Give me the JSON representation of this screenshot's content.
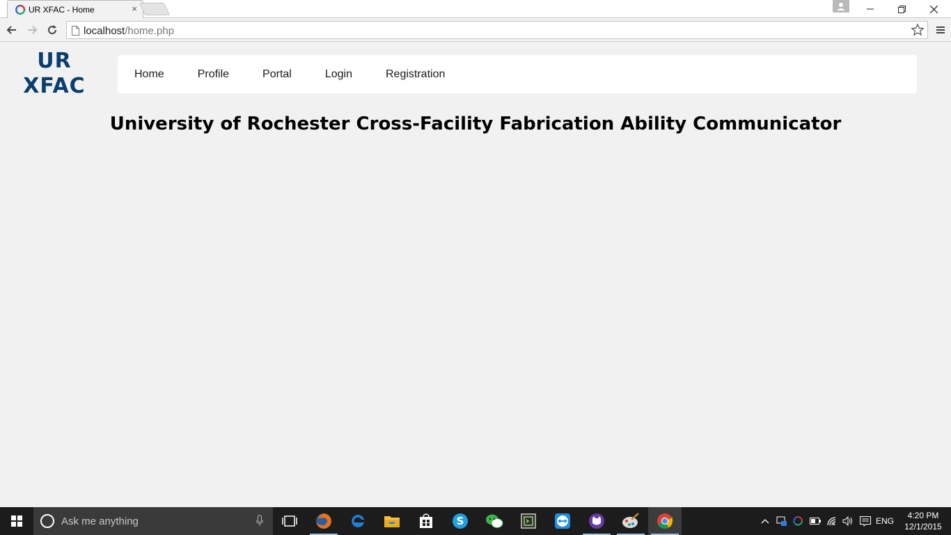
{
  "browser": {
    "tab_title": "UR XFAC - Home",
    "tab_close": "×",
    "url_host": "localhost",
    "url_path": "/home.php"
  },
  "page": {
    "logo_line1": "UR",
    "logo_line2": "XFAC",
    "nav": [
      {
        "label": "Home"
      },
      {
        "label": "Profile"
      },
      {
        "label": "Portal"
      },
      {
        "label": "Login"
      },
      {
        "label": "Registration"
      }
    ],
    "headline": "University of Rochester Cross-Facility Fabrication Ability Communicator",
    "logo_color": "#0a3e6e"
  },
  "taskbar": {
    "search_placeholder": "Ask me anything",
    "apps": [
      "task-view-icon",
      "firefox-icon",
      "edge-icon",
      "file-explorer-icon",
      "store-icon",
      "skype-icon",
      "wechat-icon",
      "terminal-app-icon",
      "teamviewer-icon",
      "purple-app-icon",
      "paint-icon",
      "chrome-icon"
    ],
    "language": "ENG",
    "time": "4:20 PM",
    "date": "12/1/2015"
  }
}
